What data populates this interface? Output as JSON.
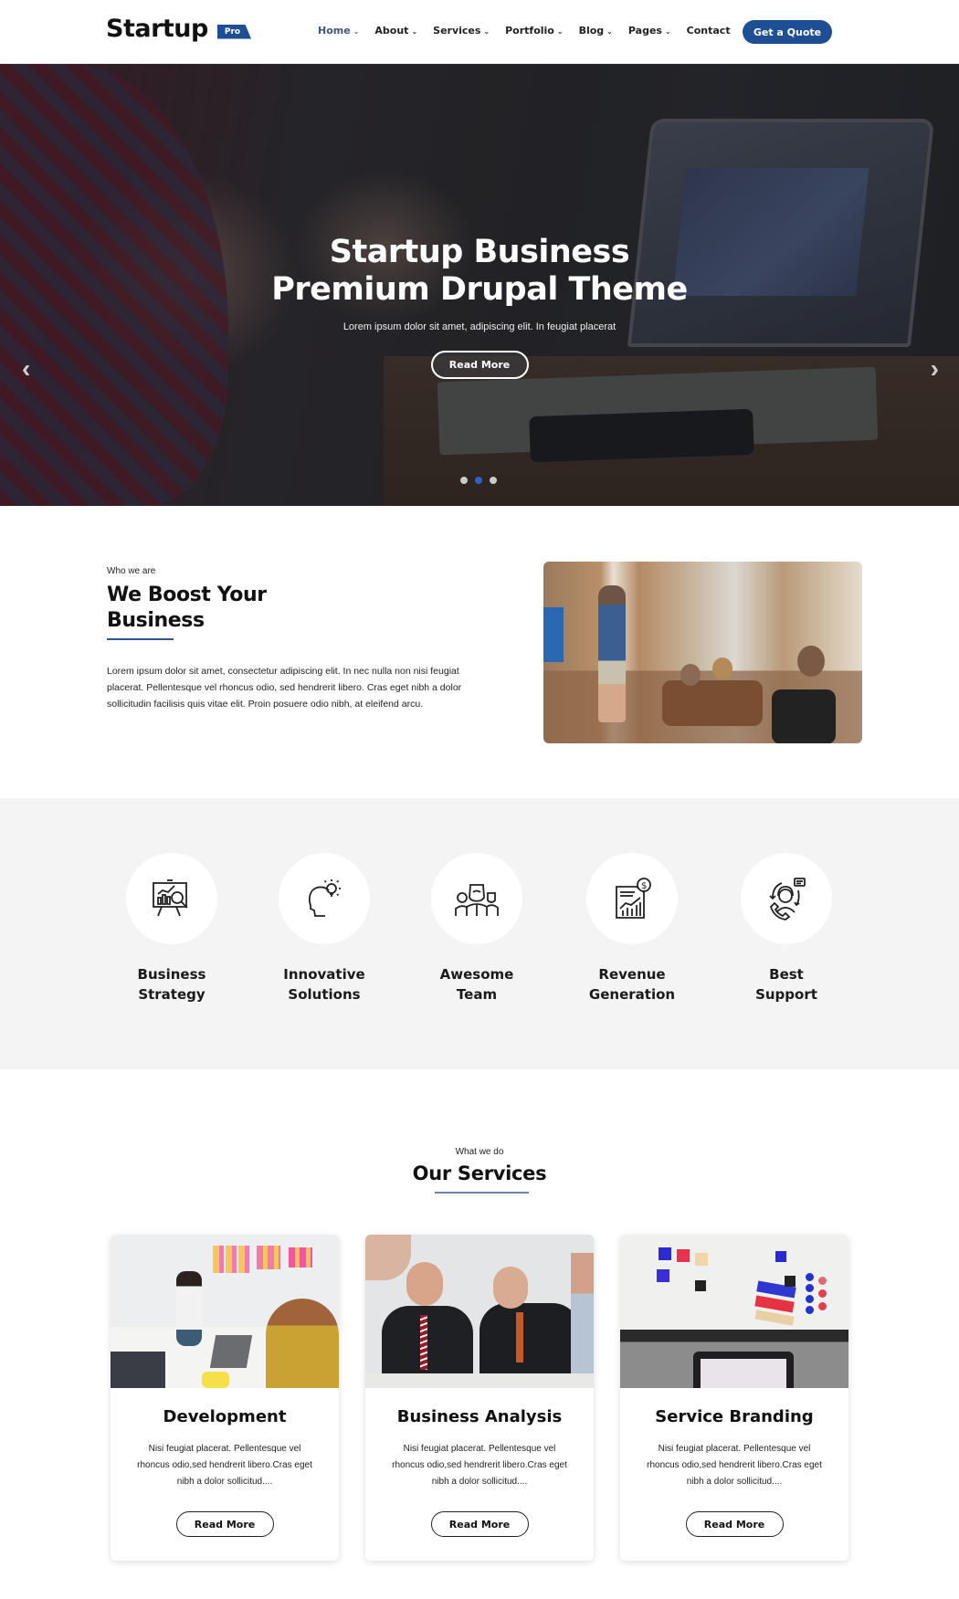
{
  "header": {
    "logo_text": "Startup",
    "logo_badge": "Pro",
    "nav": [
      {
        "label": "Home",
        "has_dropdown": true,
        "active": true
      },
      {
        "label": "About",
        "has_dropdown": true
      },
      {
        "label": "Services",
        "has_dropdown": true
      },
      {
        "label": "Portfolio",
        "has_dropdown": true
      },
      {
        "label": "Blog",
        "has_dropdown": true
      },
      {
        "label": "Pages",
        "has_dropdown": true
      },
      {
        "label": "Contact",
        "has_dropdown": false
      }
    ],
    "cta_label": "Get a Quote",
    "accent_color": "#1e4f94"
  },
  "hero": {
    "title_line1": "Startup Business",
    "title_line2": "Premium Drupal Theme",
    "subtitle": "Lorem ipsum dolor sit amet, adipiscing elit. In feugiat placerat",
    "button_label": "Read More",
    "prev_icon": "‹",
    "next_icon": "›",
    "slides_count": 3,
    "active_slide": 2
  },
  "about": {
    "kicker": "Who we are",
    "title": "We Boost Your Business",
    "text": "Lorem ipsum dolor sit amet, consectetur adipiscing elit. In nec nulla non nisi feugiat placerat. Pellentesque vel rhoncus odio, sed hendrerit libero. Cras eget nibh a dolor sollicitudin facilisis quis vitae elit. Proin posuere odio nibh, at eleifend arcu."
  },
  "features": [
    {
      "title_line1": "Business",
      "title_line2": "Strategy",
      "icon": "presentation-chart-icon"
    },
    {
      "title_line1": "Innovative",
      "title_line2": "Solutions",
      "icon": "head-lightbulb-icon"
    },
    {
      "title_line1": "Awesome",
      "title_line2": "Team",
      "icon": "team-icon"
    },
    {
      "title_line1": "Revenue",
      "title_line2": "Generation",
      "icon": "revenue-report-icon"
    },
    {
      "title_line1": "Best",
      "title_line2": "Support",
      "icon": "customer-support-icon"
    }
  ],
  "services": {
    "kicker": "What we do",
    "title": "Our Services",
    "cards": [
      {
        "title": "Development",
        "text": "Nisi feugiat placerat. Pellentesque vel rhoncus odio,sed hendrerit libero.Cras eget nibh a dolor sollicitud....",
        "button_label": "Read More"
      },
      {
        "title": "Business Analysis",
        "text": "Nisi feugiat placerat. Pellentesque vel rhoncus odio,sed hendrerit libero.Cras eget nibh a dolor sollicitud....",
        "button_label": "Read More"
      },
      {
        "title": "Service Branding",
        "text": "Nisi feugiat placerat. Pellentesque vel rhoncus odio,sed hendrerit libero.Cras eget nibh a dolor sollicitud....",
        "button_label": "Read More"
      }
    ]
  }
}
